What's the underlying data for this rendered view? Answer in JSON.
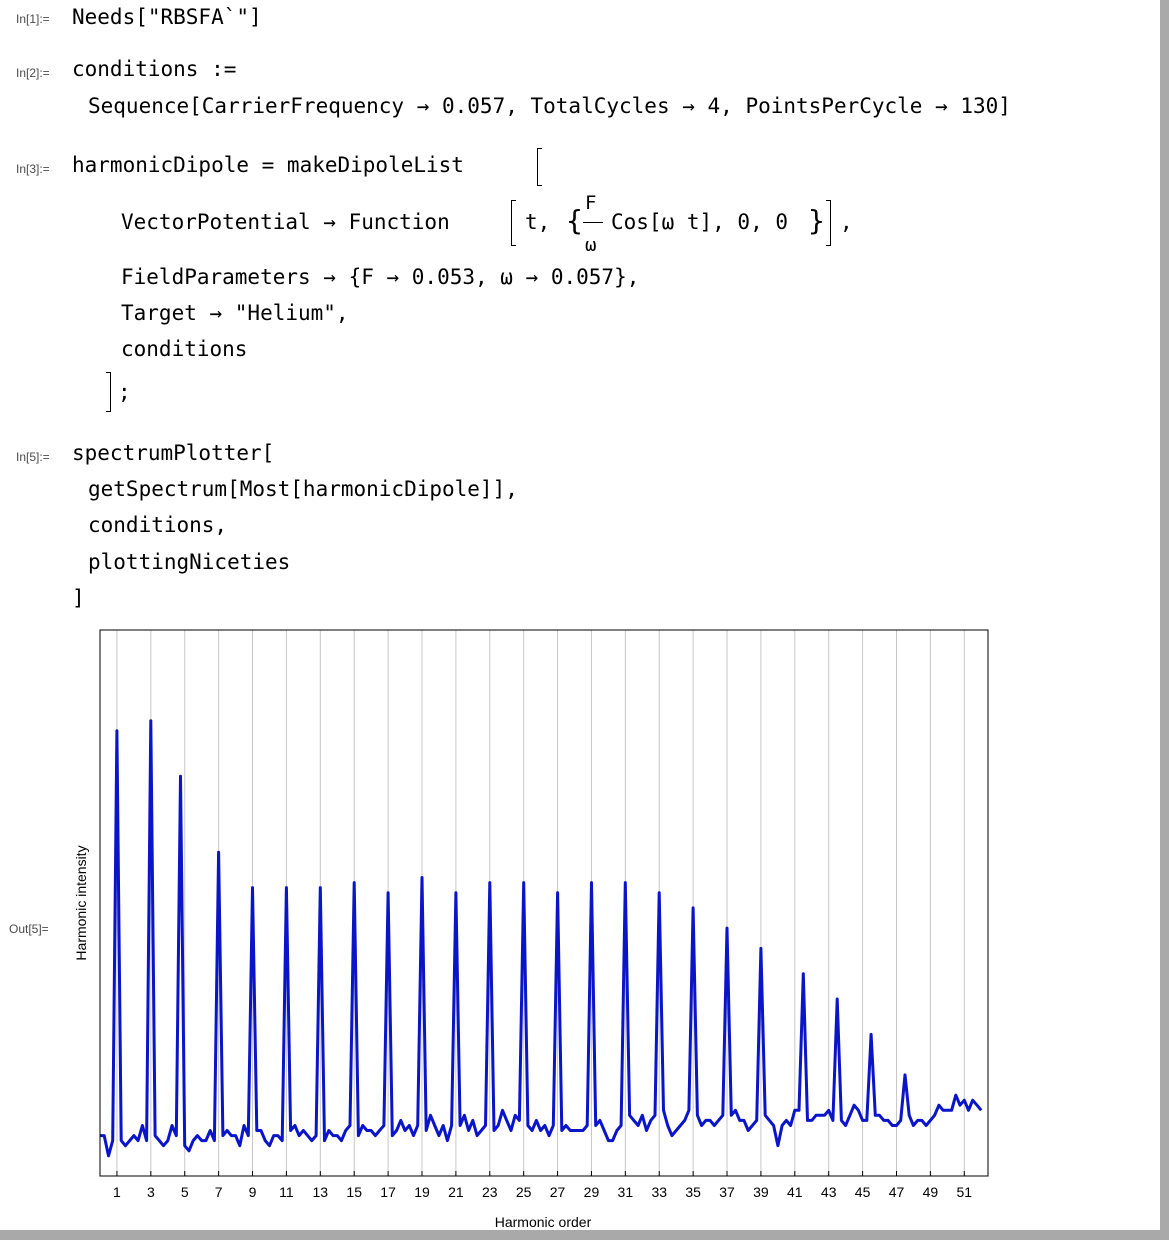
{
  "cells": {
    "in1": {
      "label": "In[1]:=",
      "line1": "Needs[\"RBSFA`\"]"
    },
    "in2": {
      "label": "In[2]:=",
      "line1": "conditions :=",
      "line2": "Sequence[CarrierFrequency → 0.057, TotalCycles → 4, PointsPerCycle → 130]"
    },
    "in3": {
      "label": "In[3]:=",
      "line1": "harmonicDipole = makeDipoleList",
      "vp_prefix": "VectorPotential → Function",
      "vp_arg": "t,",
      "frac_num": "F",
      "frac_den": "ω",
      "vp_cos": "Cos[ω t], 0, 0",
      "vp_end": ",",
      "field": "FieldParameters → {F → 0.053, ω → 0.057},",
      "target": "Target → \"Helium\",",
      "conditions": "conditions",
      "semi": ";"
    },
    "in5": {
      "label": "In[5]:=",
      "line1": "spectrumPlotter[",
      "line2": "getSpectrum[Most[harmonicDipole]],",
      "line3": "conditions,",
      "line4": "plottingNiceties",
      "line5": "]"
    },
    "out5": {
      "label": "Out[5]="
    }
  },
  "chart_data": {
    "type": "line",
    "xlabel": "Harmonic order",
    "ylabel": "Harmonic intensity",
    "xlim": [
      0,
      52.4
    ],
    "ylim": [
      0,
      100
    ],
    "xticks": [
      1,
      3,
      5,
      7,
      9,
      11,
      13,
      15,
      17,
      19,
      21,
      23,
      25,
      27,
      29,
      31,
      33,
      35,
      37,
      39,
      41,
      43,
      45,
      47,
      49,
      51
    ],
    "grid_x": true,
    "line_color": "#0a14c8",
    "x": [
      0,
      0.25,
      0.5,
      0.75,
      1,
      1.25,
      1.5,
      1.75,
      2,
      2.25,
      2.5,
      2.75,
      3,
      3.25,
      3.5,
      3.75,
      4,
      4.25,
      4.5,
      4.75,
      5,
      5.25,
      5.5,
      5.75,
      6,
      6.25,
      6.5,
      6.75,
      7,
      7.25,
      7.5,
      7.75,
      8,
      8.25,
      8.5,
      8.75,
      9,
      9.25,
      9.5,
      9.75,
      10,
      10.25,
      10.5,
      10.75,
      11,
      11.25,
      11.5,
      11.75,
      12,
      12.25,
      12.5,
      12.75,
      13,
      13.25,
      13.5,
      13.75,
      14,
      14.25,
      14.5,
      14.75,
      15,
      15.25,
      15.5,
      15.75,
      16,
      16.25,
      16.5,
      16.75,
      17,
      17.25,
      17.5,
      17.75,
      18,
      18.25,
      18.5,
      18.75,
      19,
      19.25,
      19.5,
      19.75,
      20,
      20.25,
      20.5,
      20.75,
      21,
      21.25,
      21.5,
      21.75,
      22,
      22.25,
      22.5,
      22.75,
      23,
      23.25,
      23.5,
      23.75,
      24,
      24.25,
      24.5,
      24.75,
      25,
      25.25,
      25.5,
      25.75,
      26,
      26.25,
      26.5,
      26.75,
      27,
      27.25,
      27.5,
      27.75,
      28,
      28.25,
      28.5,
      28.75,
      29,
      29.25,
      29.5,
      29.75,
      30,
      30.25,
      30.5,
      30.75,
      31,
      31.25,
      31.5,
      31.75,
      32,
      32.25,
      32.5,
      32.75,
      33,
      33.25,
      33.5,
      33.75,
      34,
      34.25,
      34.5,
      34.75,
      35,
      35.25,
      35.5,
      35.75,
      36,
      36.25,
      36.5,
      36.75,
      37,
      37.25,
      37.5,
      37.75,
      38,
      38.25,
      38.5,
      38.75,
      39,
      39.25,
      39.5,
      39.75,
      40,
      40.25,
      40.5,
      40.75,
      41,
      41.25,
      41.5,
      41.75,
      42,
      42.25,
      42.5,
      42.75,
      43,
      43.25,
      43.5,
      43.75,
      44,
      44.25,
      44.5,
      44.75,
      45,
      45.25,
      45.5,
      45.75,
      46,
      46.25,
      46.5,
      46.75,
      47,
      47.25,
      47.5,
      47.75,
      48,
      48.25,
      48.5,
      48.75,
      49,
      49.25,
      49.5,
      49.75,
      50,
      50.25,
      50.5,
      50.75,
      51,
      51.25,
      51.5,
      51.75,
      52,
      52.25,
      52.4
    ],
    "y": [
      7,
      7,
      3,
      6,
      87,
      6,
      5,
      6,
      7,
      6,
      9,
      6,
      89,
      7,
      6,
      5,
      6,
      9,
      7,
      78,
      5,
      4,
      6,
      7,
      6,
      6,
      8,
      6,
      63,
      7,
      8,
      7,
      7,
      5,
      9,
      7,
      56,
      8,
      8,
      6,
      5,
      7,
      7,
      6,
      56,
      8,
      9,
      7,
      8,
      7,
      6,
      7,
      56,
      6,
      8,
      7,
      7,
      6,
      8,
      9,
      57,
      7,
      9,
      8,
      8,
      7,
      8,
      9,
      55,
      7,
      8,
      10,
      8,
      9,
      7,
      9,
      58,
      8,
      11,
      9,
      7,
      9,
      6,
      9,
      55,
      9,
      11,
      8,
      10,
      7,
      8,
      9,
      57,
      8,
      9,
      12,
      10,
      8,
      11,
      10,
      57,
      9,
      8,
      10,
      8,
      9,
      7,
      9,
      55,
      8,
      9,
      8,
      8,
      8,
      8,
      9,
      57,
      9,
      10,
      8,
      6,
      6,
      8,
      9,
      57,
      11,
      10,
      9,
      11,
      8,
      10,
      11,
      55,
      12,
      9,
      7,
      8,
      9,
      10,
      12,
      52,
      11,
      9,
      10,
      10,
      9,
      10,
      11,
      48,
      11,
      12,
      10,
      10,
      8,
      9,
      10,
      44,
      11,
      10,
      9,
      5,
      9,
      10,
      9,
      12,
      12,
      39,
      10,
      10,
      11,
      11,
      11,
      12,
      10,
      34,
      10,
      9,
      11,
      13,
      12,
      10,
      10,
      27,
      11,
      11,
      10,
      10,
      9,
      9,
      10,
      19,
      11,
      9,
      10,
      10,
      9,
      10,
      11,
      13,
      12,
      12,
      12,
      15,
      13,
      14,
      12,
      14,
      13,
      12
    ]
  }
}
